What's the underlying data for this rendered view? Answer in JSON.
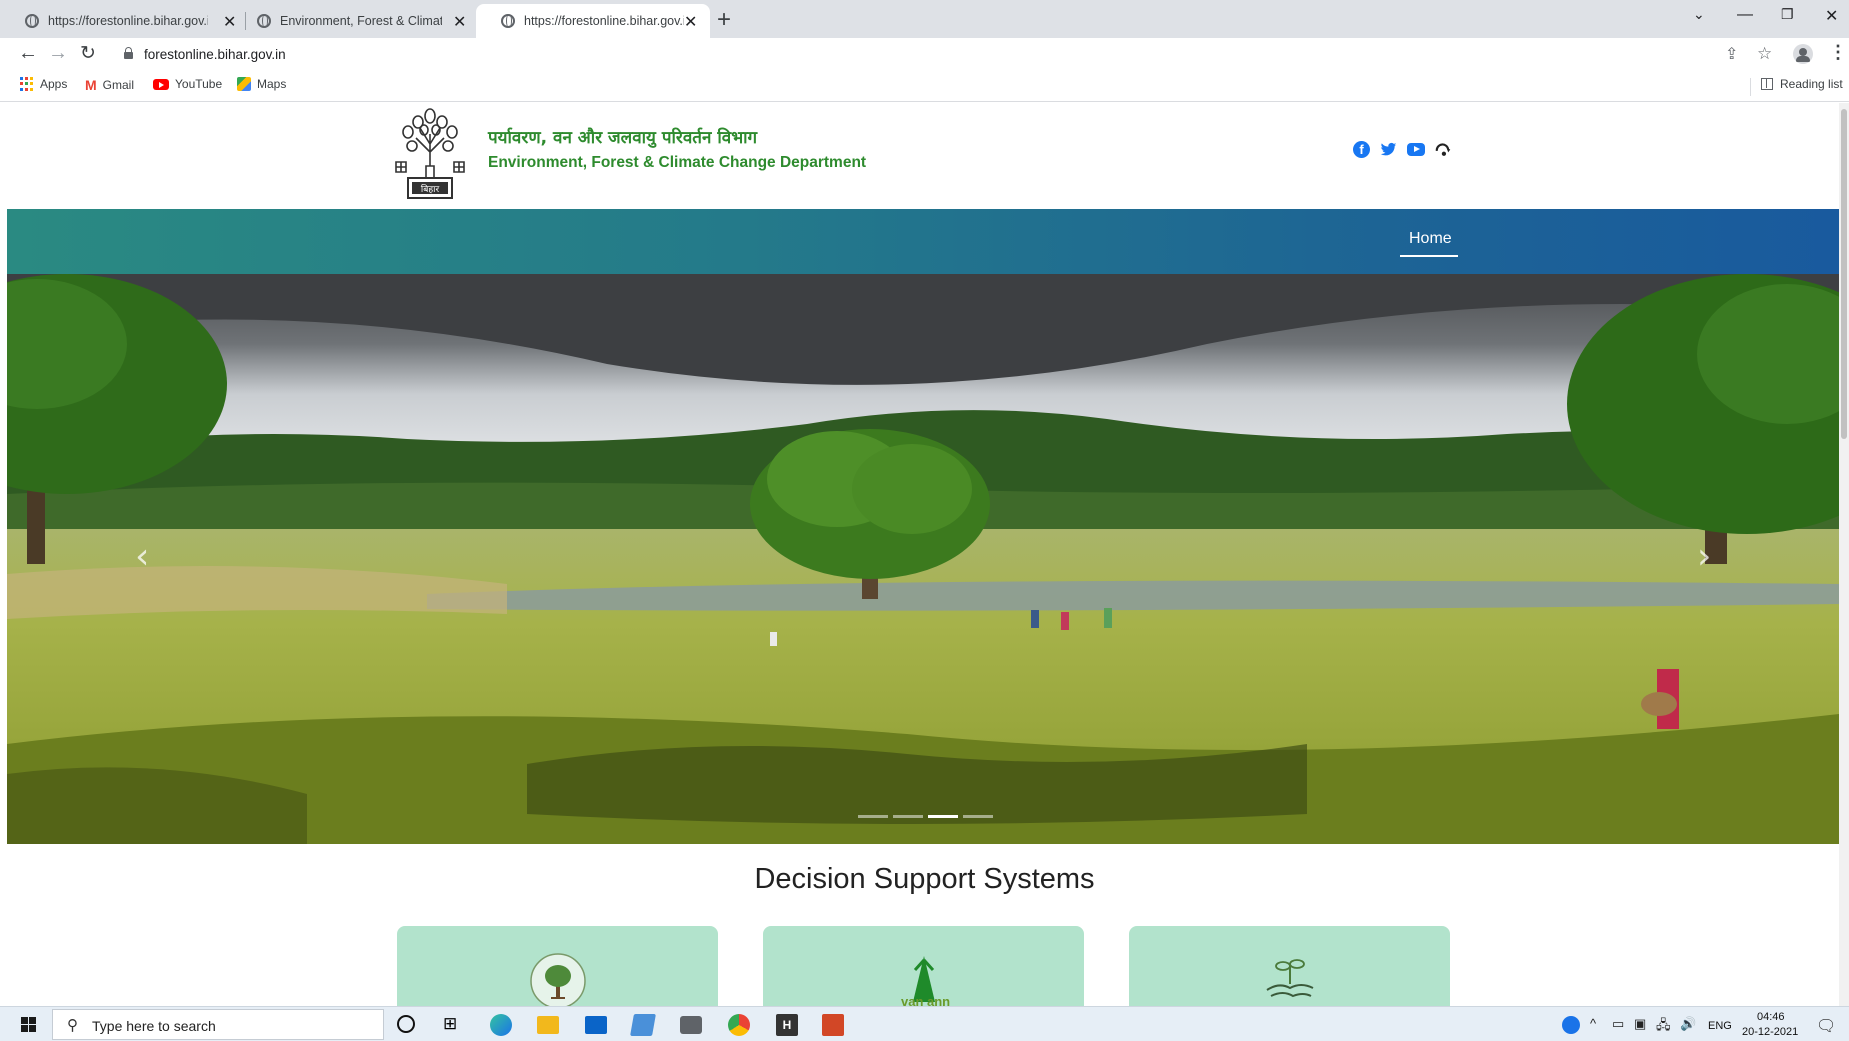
{
  "browser": {
    "tabs": [
      {
        "title": "https://forestonline.bihar.gov.in",
        "active": false
      },
      {
        "title": "Environment, Forest & Climate C",
        "active": false
      },
      {
        "title": "https://forestonline.bihar.gov.in",
        "active": true
      }
    ],
    "url": "forestonline.bihar.gov.in",
    "bookmarks": [
      {
        "label": "Apps",
        "icon": "apps-grid-icon"
      },
      {
        "label": "Gmail",
        "icon": "gmail-icon"
      },
      {
        "label": "YouTube",
        "icon": "youtube-icon"
      },
      {
        "label": "Maps",
        "icon": "maps-icon"
      }
    ],
    "reading_list": "Reading list"
  },
  "site": {
    "title_hindi": "पर्यावरण, वन और जलवायु परिवर्तन विभाग",
    "title_english": "Environment, Forest & Climate Change Department",
    "emblem_text": "बिहार",
    "social": [
      "facebook-icon",
      "twitter-icon",
      "youtube-icon",
      "accessibility-icon"
    ],
    "nav": {
      "home": "Home"
    },
    "colors": {
      "brand_green": "#2e8b2e",
      "nav_start": "#2a8a82",
      "nav_end": "#195a9e",
      "card_bg": "#b2e3cc"
    }
  },
  "carousel": {
    "slide_count": 4,
    "active_slide": 3
  },
  "main": {
    "section_title": "Decision Support Systems",
    "cards": [
      {
        "logo": "tree-seal-logo",
        "text": ""
      },
      {
        "logo": "vanann-logo",
        "text": "van ann"
      },
      {
        "logo": "hands-plant-logo",
        "text": ""
      }
    ]
  },
  "taskbar": {
    "search_placeholder": "Type here to search",
    "language": "ENG",
    "time": "04:46",
    "date": "20-12-2021"
  }
}
